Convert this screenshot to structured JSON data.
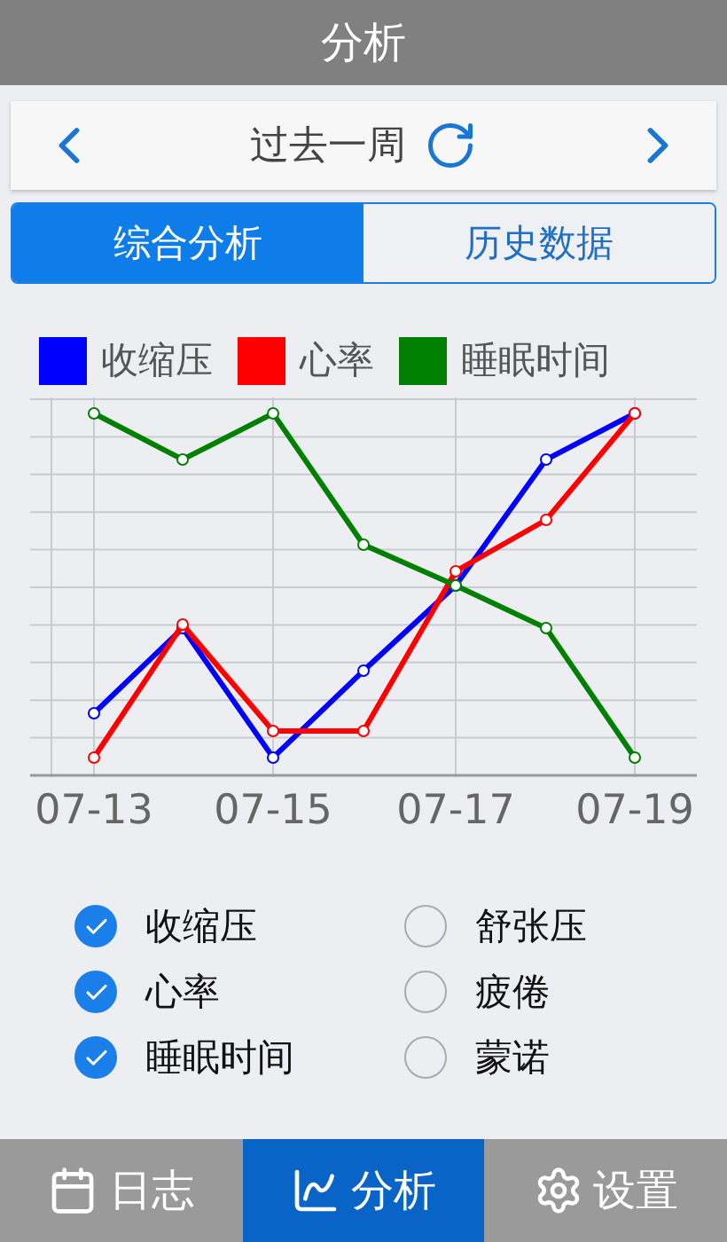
{
  "header": {
    "title": "分析"
  },
  "period": {
    "label": "过去一周"
  },
  "segments": [
    {
      "label": "综合分析",
      "selected": true
    },
    {
      "label": "历史数据",
      "selected": false
    }
  ],
  "legend": [
    {
      "label": "收缩压",
      "color": "#0000ff"
    },
    {
      "label": "心率",
      "color": "#ff0000"
    },
    {
      "label": "睡眠时间",
      "color": "#008000"
    }
  ],
  "x_labels": [
    "07-13",
    "07-15",
    "07-17",
    "07-19"
  ],
  "options": [
    {
      "label": "收缩压",
      "checked": true
    },
    {
      "label": "舒张压",
      "checked": false
    },
    {
      "label": "心率",
      "checked": true
    },
    {
      "label": "疲倦",
      "checked": false
    },
    {
      "label": "睡眠时间",
      "checked": true
    },
    {
      "label": "蒙诺",
      "checked": false
    }
  ],
  "bottom_tabs": [
    {
      "label": "日志",
      "kind": "log",
      "selected": false
    },
    {
      "label": "分析",
      "kind": "analysis",
      "selected": true
    },
    {
      "label": "设置",
      "kind": "settings",
      "selected": false
    }
  ]
}
